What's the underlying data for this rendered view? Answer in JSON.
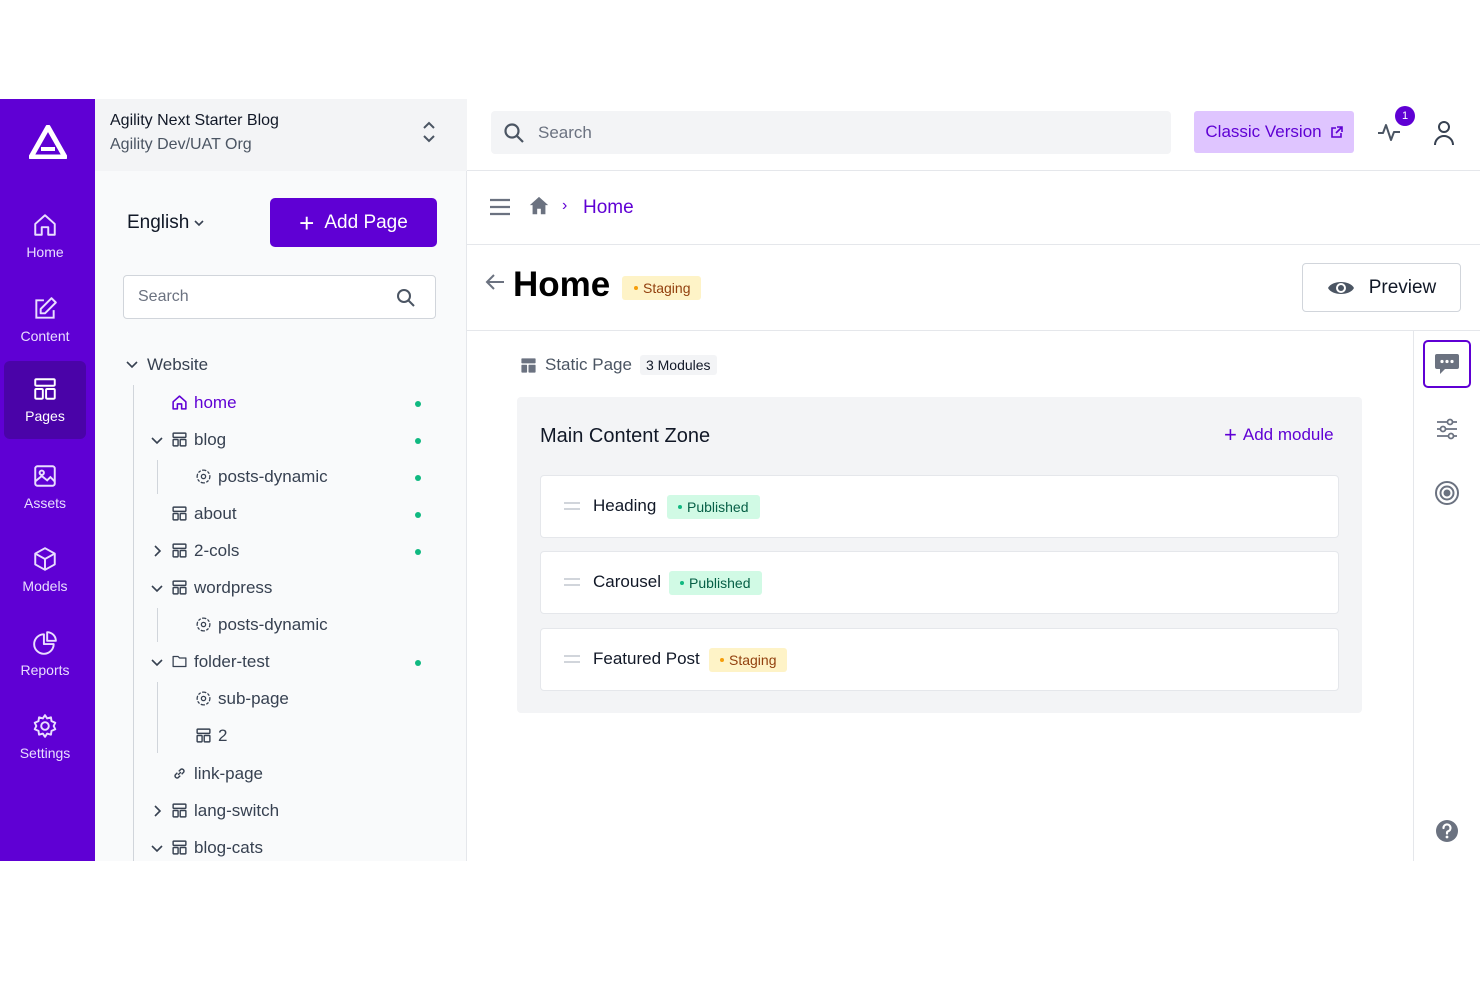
{
  "nav": {
    "items": [
      {
        "label": "Home",
        "icon": "home-icon"
      },
      {
        "label": "Content",
        "icon": "edit-icon"
      },
      {
        "label": "Pages",
        "icon": "pages-icon"
      },
      {
        "label": "Assets",
        "icon": "image-icon"
      },
      {
        "label": "Models",
        "icon": "cube-icon"
      },
      {
        "label": "Reports",
        "icon": "pie-chart-icon"
      },
      {
        "label": "Settings",
        "icon": "gear-icon"
      }
    ],
    "active": "Pages"
  },
  "instance": {
    "name": "Agility Next Starter Blog",
    "org": "Agility Dev/UAT Org"
  },
  "tree_panel": {
    "language": "English",
    "add_page_label": "Add Page",
    "search_placeholder": "Search",
    "root_label": "Website",
    "nodes": [
      {
        "label": "home",
        "type": "page",
        "published": true,
        "active": true
      },
      {
        "label": "blog",
        "type": "page",
        "published": true
      },
      {
        "label": "posts-dynamic",
        "type": "dynamic",
        "published": true
      },
      {
        "label": "about",
        "type": "page",
        "published": true
      },
      {
        "label": "2-cols",
        "type": "page",
        "published": true
      },
      {
        "label": "wordpress",
        "type": "page",
        "published": false
      },
      {
        "label": "posts-dynamic",
        "type": "dynamic",
        "published": false
      },
      {
        "label": "folder-test",
        "type": "folder",
        "published": true
      },
      {
        "label": "sub-page",
        "type": "dynamic",
        "published": false
      },
      {
        "label": "2",
        "type": "page",
        "published": false
      },
      {
        "label": "link-page",
        "type": "link",
        "published": false
      },
      {
        "label": "lang-switch",
        "type": "page",
        "published": false
      },
      {
        "label": "blog-cats",
        "type": "page",
        "published": false
      }
    ]
  },
  "topbar": {
    "search_placeholder": "Search",
    "classic_label": "Classic Version",
    "notification_count": "1"
  },
  "breadcrumb": {
    "current": "Home",
    "separator": "›"
  },
  "page": {
    "title": "Home",
    "status": "Staging",
    "preview_label": "Preview",
    "type_label": "Static Page",
    "module_count": "3 Modules"
  },
  "zone": {
    "title": "Main Content Zone",
    "add_module_label": "Add module",
    "modules": [
      {
        "name": "Heading",
        "status": "Published"
      },
      {
        "name": "Carousel",
        "status": "Published"
      },
      {
        "name": "Featured Post",
        "status": "Staging"
      }
    ]
  },
  "colors": {
    "brand": "#5f00d4",
    "brand_light": "#dfc5ff",
    "published": "#10b981",
    "staging": "#f59e0b"
  }
}
